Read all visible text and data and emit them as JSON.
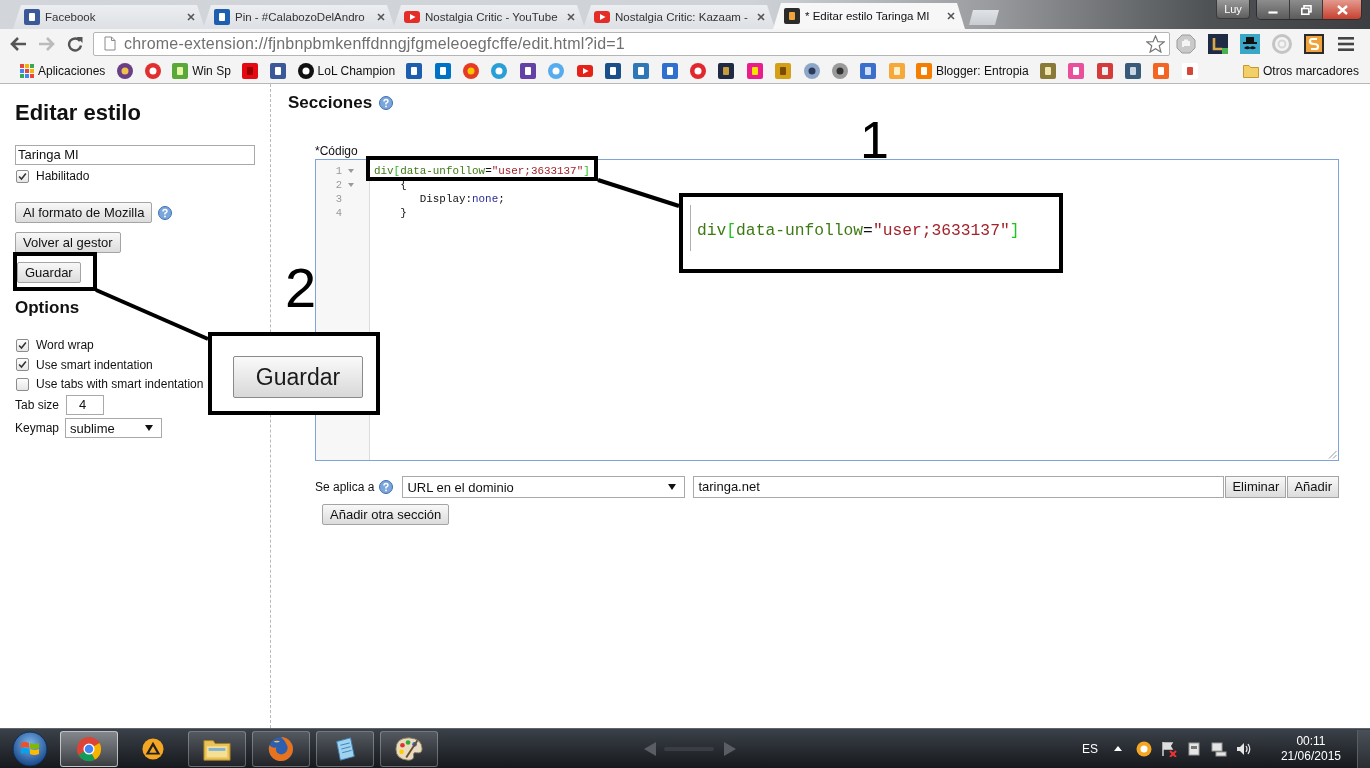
{
  "browser": {
    "tabs": [
      {
        "title": "Facebook",
        "selected": false
      },
      {
        "title": "Pin - #CalabozoDelAndro",
        "selected": false
      },
      {
        "title": "Nostalgia Critic - YouTube",
        "selected": false
      },
      {
        "title": "Nostalgia Critic: Kazaam -",
        "selected": false
      },
      {
        "title": "* Editar estilo Taringa MI",
        "selected": true
      }
    ],
    "profile": "Luy",
    "url": "chrome-extension://fjnbnpbmkenffdnngjfgmeleoegfcffe/edit.html?id=1",
    "bookmarks": [
      {
        "label": "Aplicaciones"
      },
      {
        "label": "Win Sp"
      },
      {
        "label": "LoL Champion"
      },
      {
        "label": "Blogger: Entropia"
      }
    ],
    "other_bookmarks": "Otros marcadores"
  },
  "sidebar": {
    "title": "Editar estilo",
    "name": "Taringa MI",
    "enabled": {
      "label": "Habilitado",
      "checked": true
    },
    "buttons": [
      "Al formato de Mozilla",
      "Volver al gestor",
      "Guardar"
    ],
    "options_title": "Options",
    "options": [
      {
        "label": "Word wrap",
        "checked": true
      },
      {
        "label": "Use smart indentation",
        "checked": true
      },
      {
        "label": "Use tabs with smart indentation",
        "checked": false
      }
    ],
    "tab_size": {
      "label": "Tab size",
      "value": "4"
    },
    "keymap": {
      "label": "Keymap",
      "value": "sublime"
    }
  },
  "sections": {
    "title": "Secciones",
    "code_label": "*Código",
    "code_lines": [
      {
        "number": "1",
        "fold": true,
        "tokens": [
          {
            "text": "div",
            "kind": "tag"
          },
          {
            "text": "[",
            "kind": "bracket"
          },
          {
            "text": "data-unfollow",
            "kind": "attribute"
          },
          {
            "text": "=",
            "kind": "operator"
          },
          {
            "text": "\"user;3633137\"",
            "kind": "string"
          },
          {
            "text": "]",
            "kind": "bracket"
          }
        ]
      },
      {
        "number": "2",
        "fold": true,
        "tokens": [
          {
            "text": "    {",
            "kind": "plain"
          }
        ]
      },
      {
        "number": "3",
        "fold": false,
        "tokens": [
          {
            "text": "       Display",
            "kind": "property"
          },
          {
            "text": ":",
            "kind": "operator"
          },
          {
            "text": "none",
            "kind": "value"
          },
          {
            "text": ";",
            "kind": "operator"
          }
        ]
      },
      {
        "number": "4",
        "fold": false,
        "tokens": [
          {
            "text": "    }",
            "kind": "plain"
          }
        ]
      }
    ],
    "applies": {
      "label": "Se aplica a",
      "type": "URL en el dominio",
      "value": "taringa.net"
    },
    "buttons": [
      "Eliminar",
      "Añadir"
    ],
    "add_section": "Añadir otra sección"
  },
  "annotations": [
    {
      "number": "1",
      "kind": "code",
      "tokens": [
        {
          "text": "div",
          "kind": "tag"
        },
        {
          "text": "[",
          "kind": "bracket"
        },
        {
          "text": "data-unfollow",
          "kind": "attribute"
        },
        {
          "text": "=",
          "kind": "operator"
        },
        {
          "text": "\"user;3633137\"",
          "kind": "string"
        },
        {
          "text": "]",
          "kind": "bracket"
        }
      ]
    },
    {
      "number": "2",
      "kind": "button",
      "text": "Guardar"
    }
  ],
  "taskbar": {
    "language": "ES",
    "time": "00:11",
    "date": "21/06/2015"
  }
}
